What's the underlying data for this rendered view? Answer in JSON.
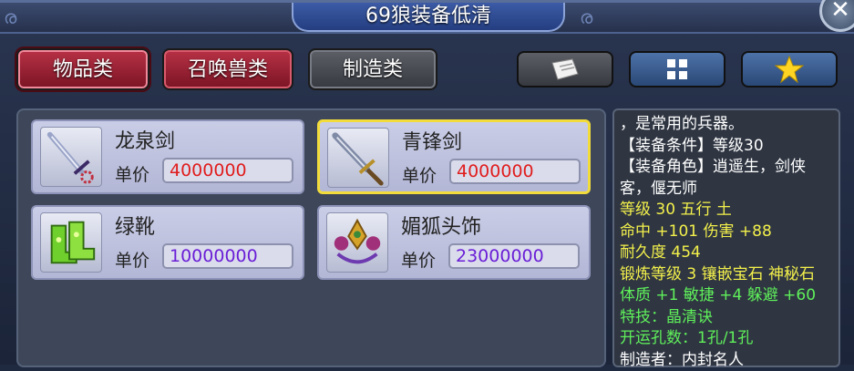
{
  "window": {
    "title": "69狼装备低清"
  },
  "tabs": [
    {
      "label": "物品类",
      "active": true
    },
    {
      "label": "召唤兽类",
      "active": false
    },
    {
      "label": "制造类",
      "active": false
    }
  ],
  "toolbar": {
    "icons": [
      "book-icon",
      "grid-icon",
      "star-icon"
    ]
  },
  "items": [
    {
      "name": "龙泉剑",
      "price_label": "单价",
      "price": "4000000",
      "price_color": "#e01d1d",
      "icon": "sword-icon",
      "selected": false
    },
    {
      "name": "青锋剑",
      "price_label": "单价",
      "price": "4000000",
      "price_color": "#e01d1d",
      "icon": "blade-icon",
      "selected": true
    },
    {
      "name": "绿靴",
      "price_label": "单价",
      "price": "10000000",
      "price_color": "#6a1ed6",
      "icon": "boots-icon",
      "selected": false
    },
    {
      "name": "媚狐头饰",
      "price_label": "单价",
      "price": "23000000",
      "price_color": "#6a1ed6",
      "icon": "headdress-icon",
      "selected": false
    }
  ],
  "description": {
    "lines": [
      {
        "text": "，是常用的兵器。",
        "color": "white"
      },
      {
        "text": "【装备条件】等级30",
        "color": "white"
      },
      {
        "text": "【装备角色】逍遥生，剑侠客，偃无师",
        "color": "white"
      },
      {
        "text": "等级 30  五行 土",
        "color": "yellow"
      },
      {
        "text": "命中 +101 伤害 +88",
        "color": "yellow"
      },
      {
        "text": "耐久度 454",
        "color": "yellow"
      },
      {
        "text": "锻炼等级 3  镶嵌宝石 神秘石",
        "color": "yellow"
      },
      {
        "text": "体质 +1 敏捷 +4 躲避 +60",
        "color": "green"
      },
      {
        "text": "特技：晶清诀",
        "color": "green"
      },
      {
        "text": "开运孔数：1孔/1孔",
        "color": "green"
      },
      {
        "text": "制造者：内封名人",
        "color": "white"
      }
    ]
  }
}
